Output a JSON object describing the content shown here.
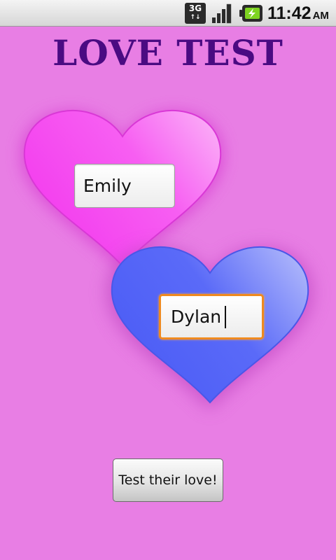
{
  "status_bar": {
    "network_type": "3G",
    "network_icon": "network-3g-icon",
    "signal_icon": "signal-strength-icon",
    "battery_icon": "battery-charging-icon",
    "time": "11:42",
    "ampm": "AM"
  },
  "app": {
    "title": "LOVE TEST"
  },
  "form": {
    "first_name": {
      "value": "Emily"
    },
    "second_name": {
      "value": "Dylan"
    },
    "submit_label": "Test their love!"
  },
  "colors": {
    "background": "#e87ee4",
    "title": "#4a0b82",
    "heart_pink": "#f544ef",
    "heart_blue": "#5564f8",
    "focus_border": "#ef8a1f"
  }
}
